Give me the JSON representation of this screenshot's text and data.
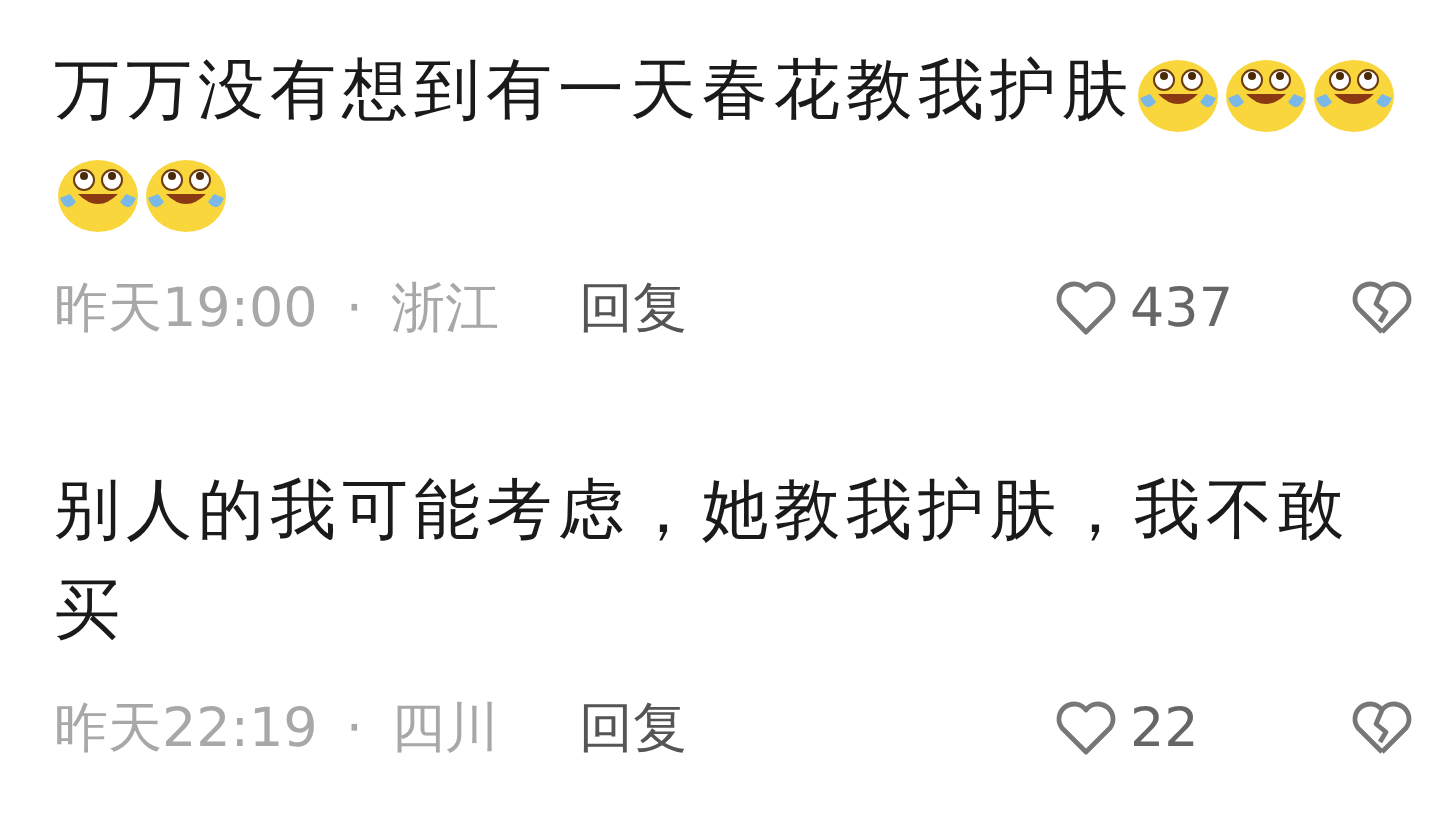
{
  "comments": [
    {
      "text": "万万没有想到有一天春花教我护肤",
      "emojis": [
        {
          "kind": "laugh-cry"
        },
        {
          "kind": "laugh-cry"
        },
        {
          "kind": "laugh-cry"
        },
        {
          "kind": "laugh-cry"
        },
        {
          "kind": "laugh-cry"
        }
      ],
      "time": "昨天19:00",
      "separator": "·",
      "location": "浙江",
      "reply": "回复",
      "likes": "437"
    },
    {
      "text": "别人的我可能考虑，她教我护肤，我不敢买",
      "time": "昨天22:19",
      "separator": "·",
      "location": "四川",
      "reply": "回复",
      "likes": "22"
    }
  ]
}
